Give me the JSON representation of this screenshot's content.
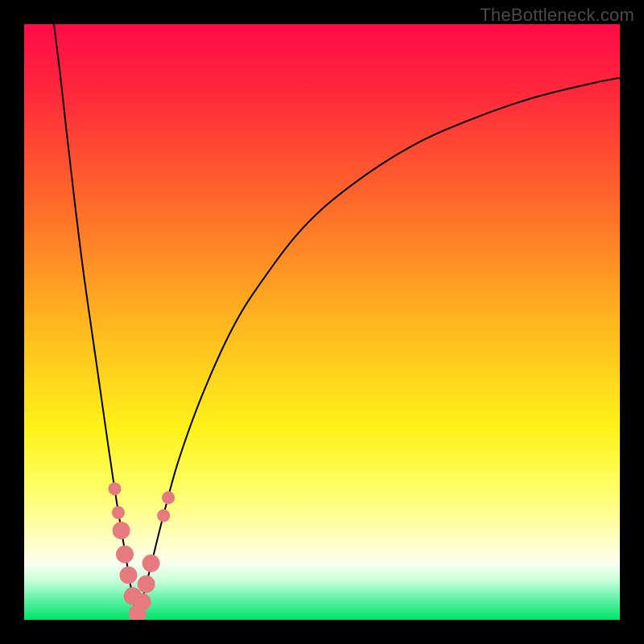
{
  "watermark": "TheBottleneck.com",
  "chart_data": {
    "type": "line",
    "title": "",
    "xlabel": "",
    "ylabel": "",
    "xlim": [
      0,
      100
    ],
    "ylim": [
      0,
      100
    ],
    "grid": false,
    "legend": false,
    "background": {
      "type": "vertical-gradient",
      "stops": [
        {
          "pos": 0.0,
          "color": "#ff0b47"
        },
        {
          "pos": 0.12,
          "color": "#ff2a3b"
        },
        {
          "pos": 0.3,
          "color": "#ff6a2a"
        },
        {
          "pos": 0.5,
          "color": "#ffb61f"
        },
        {
          "pos": 0.68,
          "color": "#fff21a"
        },
        {
          "pos": 0.78,
          "color": "#ffff66"
        },
        {
          "pos": 0.85,
          "color": "#ffffb0"
        },
        {
          "pos": 0.905,
          "color": "#fafff0"
        },
        {
          "pos": 0.935,
          "color": "#c4ffda"
        },
        {
          "pos": 0.965,
          "color": "#62f2a8"
        },
        {
          "pos": 1.0,
          "color": "#00e36b"
        }
      ]
    },
    "series": [
      {
        "name": "left-branch",
        "values": [
          {
            "x": 5.0,
            "y": 100.0
          },
          {
            "x": 6.0,
            "y": 92.0
          },
          {
            "x": 7.0,
            "y": 83.0
          },
          {
            "x": 8.5,
            "y": 70.0
          },
          {
            "x": 10.0,
            "y": 58.0
          },
          {
            "x": 12.0,
            "y": 44.0
          },
          {
            "x": 14.0,
            "y": 30.0
          },
          {
            "x": 15.5,
            "y": 20.0
          },
          {
            "x": 17.0,
            "y": 11.0
          },
          {
            "x": 18.0,
            "y": 5.0
          },
          {
            "x": 19.0,
            "y": 0.0
          }
        ]
      },
      {
        "name": "right-branch",
        "values": [
          {
            "x": 19.0,
            "y": 0.0
          },
          {
            "x": 20.0,
            "y": 4.0
          },
          {
            "x": 21.5,
            "y": 10.0
          },
          {
            "x": 23.5,
            "y": 18.0
          },
          {
            "x": 26.0,
            "y": 27.0
          },
          {
            "x": 30.0,
            "y": 38.0
          },
          {
            "x": 35.0,
            "y": 49.0
          },
          {
            "x": 40.0,
            "y": 57.0
          },
          {
            "x": 47.0,
            "y": 66.0
          },
          {
            "x": 55.0,
            "y": 73.0
          },
          {
            "x": 65.0,
            "y": 79.5
          },
          {
            "x": 75.0,
            "y": 84.0
          },
          {
            "x": 85.0,
            "y": 87.5
          },
          {
            "x": 95.0,
            "y": 90.0
          },
          {
            "x": 100.0,
            "y": 91.0
          }
        ]
      }
    ],
    "markers": {
      "name": "highlighted-points",
      "color": "#e77a7f",
      "radius_small": 8,
      "radius_large": 11,
      "points": [
        {
          "x": 15.2,
          "y": 22.0,
          "r": "small"
        },
        {
          "x": 15.8,
          "y": 18.0,
          "r": "small"
        },
        {
          "x": 16.3,
          "y": 15.0,
          "r": "large"
        },
        {
          "x": 16.9,
          "y": 11.0,
          "r": "large"
        },
        {
          "x": 17.5,
          "y": 7.5,
          "r": "large"
        },
        {
          "x": 18.2,
          "y": 4.0,
          "r": "large"
        },
        {
          "x": 19.0,
          "y": 1.0,
          "r": "large"
        },
        {
          "x": 19.8,
          "y": 3.0,
          "r": "large"
        },
        {
          "x": 20.5,
          "y": 6.0,
          "r": "large"
        },
        {
          "x": 21.3,
          "y": 9.5,
          "r": "large"
        },
        {
          "x": 23.4,
          "y": 17.5,
          "r": "small"
        },
        {
          "x": 24.2,
          "y": 20.5,
          "r": "small"
        }
      ]
    }
  }
}
